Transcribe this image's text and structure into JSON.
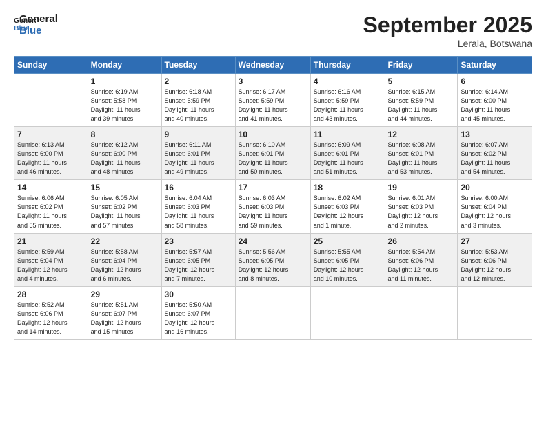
{
  "header": {
    "logo_line1": "General",
    "logo_line2": "Blue",
    "month_title": "September 2025",
    "location": "Lerala, Botswana"
  },
  "days_of_week": [
    "Sunday",
    "Monday",
    "Tuesday",
    "Wednesday",
    "Thursday",
    "Friday",
    "Saturday"
  ],
  "weeks": [
    [
      {
        "day": "",
        "info": ""
      },
      {
        "day": "1",
        "info": "Sunrise: 6:19 AM\nSunset: 5:58 PM\nDaylight: 11 hours\nand 39 minutes."
      },
      {
        "day": "2",
        "info": "Sunrise: 6:18 AM\nSunset: 5:59 PM\nDaylight: 11 hours\nand 40 minutes."
      },
      {
        "day": "3",
        "info": "Sunrise: 6:17 AM\nSunset: 5:59 PM\nDaylight: 11 hours\nand 41 minutes."
      },
      {
        "day": "4",
        "info": "Sunrise: 6:16 AM\nSunset: 5:59 PM\nDaylight: 11 hours\nand 43 minutes."
      },
      {
        "day": "5",
        "info": "Sunrise: 6:15 AM\nSunset: 5:59 PM\nDaylight: 11 hours\nand 44 minutes."
      },
      {
        "day": "6",
        "info": "Sunrise: 6:14 AM\nSunset: 6:00 PM\nDaylight: 11 hours\nand 45 minutes."
      }
    ],
    [
      {
        "day": "7",
        "info": "Sunrise: 6:13 AM\nSunset: 6:00 PM\nDaylight: 11 hours\nand 46 minutes."
      },
      {
        "day": "8",
        "info": "Sunrise: 6:12 AM\nSunset: 6:00 PM\nDaylight: 11 hours\nand 48 minutes."
      },
      {
        "day": "9",
        "info": "Sunrise: 6:11 AM\nSunset: 6:01 PM\nDaylight: 11 hours\nand 49 minutes."
      },
      {
        "day": "10",
        "info": "Sunrise: 6:10 AM\nSunset: 6:01 PM\nDaylight: 11 hours\nand 50 minutes."
      },
      {
        "day": "11",
        "info": "Sunrise: 6:09 AM\nSunset: 6:01 PM\nDaylight: 11 hours\nand 51 minutes."
      },
      {
        "day": "12",
        "info": "Sunrise: 6:08 AM\nSunset: 6:01 PM\nDaylight: 11 hours\nand 53 minutes."
      },
      {
        "day": "13",
        "info": "Sunrise: 6:07 AM\nSunset: 6:02 PM\nDaylight: 11 hours\nand 54 minutes."
      }
    ],
    [
      {
        "day": "14",
        "info": "Sunrise: 6:06 AM\nSunset: 6:02 PM\nDaylight: 11 hours\nand 55 minutes."
      },
      {
        "day": "15",
        "info": "Sunrise: 6:05 AM\nSunset: 6:02 PM\nDaylight: 11 hours\nand 57 minutes."
      },
      {
        "day": "16",
        "info": "Sunrise: 6:04 AM\nSunset: 6:03 PM\nDaylight: 11 hours\nand 58 minutes."
      },
      {
        "day": "17",
        "info": "Sunrise: 6:03 AM\nSunset: 6:03 PM\nDaylight: 11 hours\nand 59 minutes."
      },
      {
        "day": "18",
        "info": "Sunrise: 6:02 AM\nSunset: 6:03 PM\nDaylight: 12 hours\nand 1 minute."
      },
      {
        "day": "19",
        "info": "Sunrise: 6:01 AM\nSunset: 6:03 PM\nDaylight: 12 hours\nand 2 minutes."
      },
      {
        "day": "20",
        "info": "Sunrise: 6:00 AM\nSunset: 6:04 PM\nDaylight: 12 hours\nand 3 minutes."
      }
    ],
    [
      {
        "day": "21",
        "info": "Sunrise: 5:59 AM\nSunset: 6:04 PM\nDaylight: 12 hours\nand 4 minutes."
      },
      {
        "day": "22",
        "info": "Sunrise: 5:58 AM\nSunset: 6:04 PM\nDaylight: 12 hours\nand 6 minutes."
      },
      {
        "day": "23",
        "info": "Sunrise: 5:57 AM\nSunset: 6:05 PM\nDaylight: 12 hours\nand 7 minutes."
      },
      {
        "day": "24",
        "info": "Sunrise: 5:56 AM\nSunset: 6:05 PM\nDaylight: 12 hours\nand 8 minutes."
      },
      {
        "day": "25",
        "info": "Sunrise: 5:55 AM\nSunset: 6:05 PM\nDaylight: 12 hours\nand 10 minutes."
      },
      {
        "day": "26",
        "info": "Sunrise: 5:54 AM\nSunset: 6:06 PM\nDaylight: 12 hours\nand 11 minutes."
      },
      {
        "day": "27",
        "info": "Sunrise: 5:53 AM\nSunset: 6:06 PM\nDaylight: 12 hours\nand 12 minutes."
      }
    ],
    [
      {
        "day": "28",
        "info": "Sunrise: 5:52 AM\nSunset: 6:06 PM\nDaylight: 12 hours\nand 14 minutes."
      },
      {
        "day": "29",
        "info": "Sunrise: 5:51 AM\nSunset: 6:07 PM\nDaylight: 12 hours\nand 15 minutes."
      },
      {
        "day": "30",
        "info": "Sunrise: 5:50 AM\nSunset: 6:07 PM\nDaylight: 12 hours\nand 16 minutes."
      },
      {
        "day": "",
        "info": ""
      },
      {
        "day": "",
        "info": ""
      },
      {
        "day": "",
        "info": ""
      },
      {
        "day": "",
        "info": ""
      }
    ]
  ]
}
